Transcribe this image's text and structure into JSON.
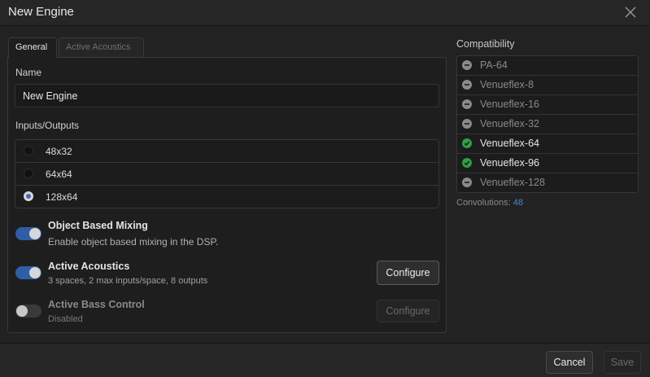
{
  "window": {
    "title": "New Engine"
  },
  "tabs": [
    {
      "label": "General",
      "active": true
    },
    {
      "label": "Active Acoustics",
      "active": false
    }
  ],
  "general": {
    "name_label": "Name",
    "name_value": "New Engine",
    "io_label": "Inputs/Outputs",
    "io_options": [
      {
        "label": "48x32",
        "selected": false
      },
      {
        "label": "64x64",
        "selected": false
      },
      {
        "label": "128x64",
        "selected": true
      }
    ],
    "object_mixing": {
      "title": "Object Based Mixing",
      "description": "Enable object based mixing in the DSP.",
      "enabled": true
    },
    "active_acoustics": {
      "title": "Active Acoustics",
      "description": "3 spaces, 2 max inputs/space, 8 outputs",
      "enabled": true,
      "configure_label": "Configure"
    },
    "active_bass": {
      "title": "Active Bass Control",
      "description": "Disabled",
      "enabled": false,
      "configure_label": "Configure"
    }
  },
  "compatibility": {
    "label": "Compatibility",
    "items": [
      {
        "name": "PA-64",
        "supported": false
      },
      {
        "name": "Venueflex-8",
        "supported": false
      },
      {
        "name": "Venueflex-16",
        "supported": false
      },
      {
        "name": "Venueflex-32",
        "supported": false
      },
      {
        "name": "Venueflex-64",
        "supported": true
      },
      {
        "name": "Venueflex-96",
        "supported": true
      },
      {
        "name": "Venueflex-128",
        "supported": false
      }
    ],
    "convolutions_label": "Convolutions:",
    "convolutions_value": "48"
  },
  "footer": {
    "cancel_label": "Cancel",
    "save_label": "Save"
  },
  "colors": {
    "accent": "#2f5ea8",
    "supported": "#2ea043",
    "unsupported": "#8a8a8a",
    "link": "#4a89d0"
  }
}
